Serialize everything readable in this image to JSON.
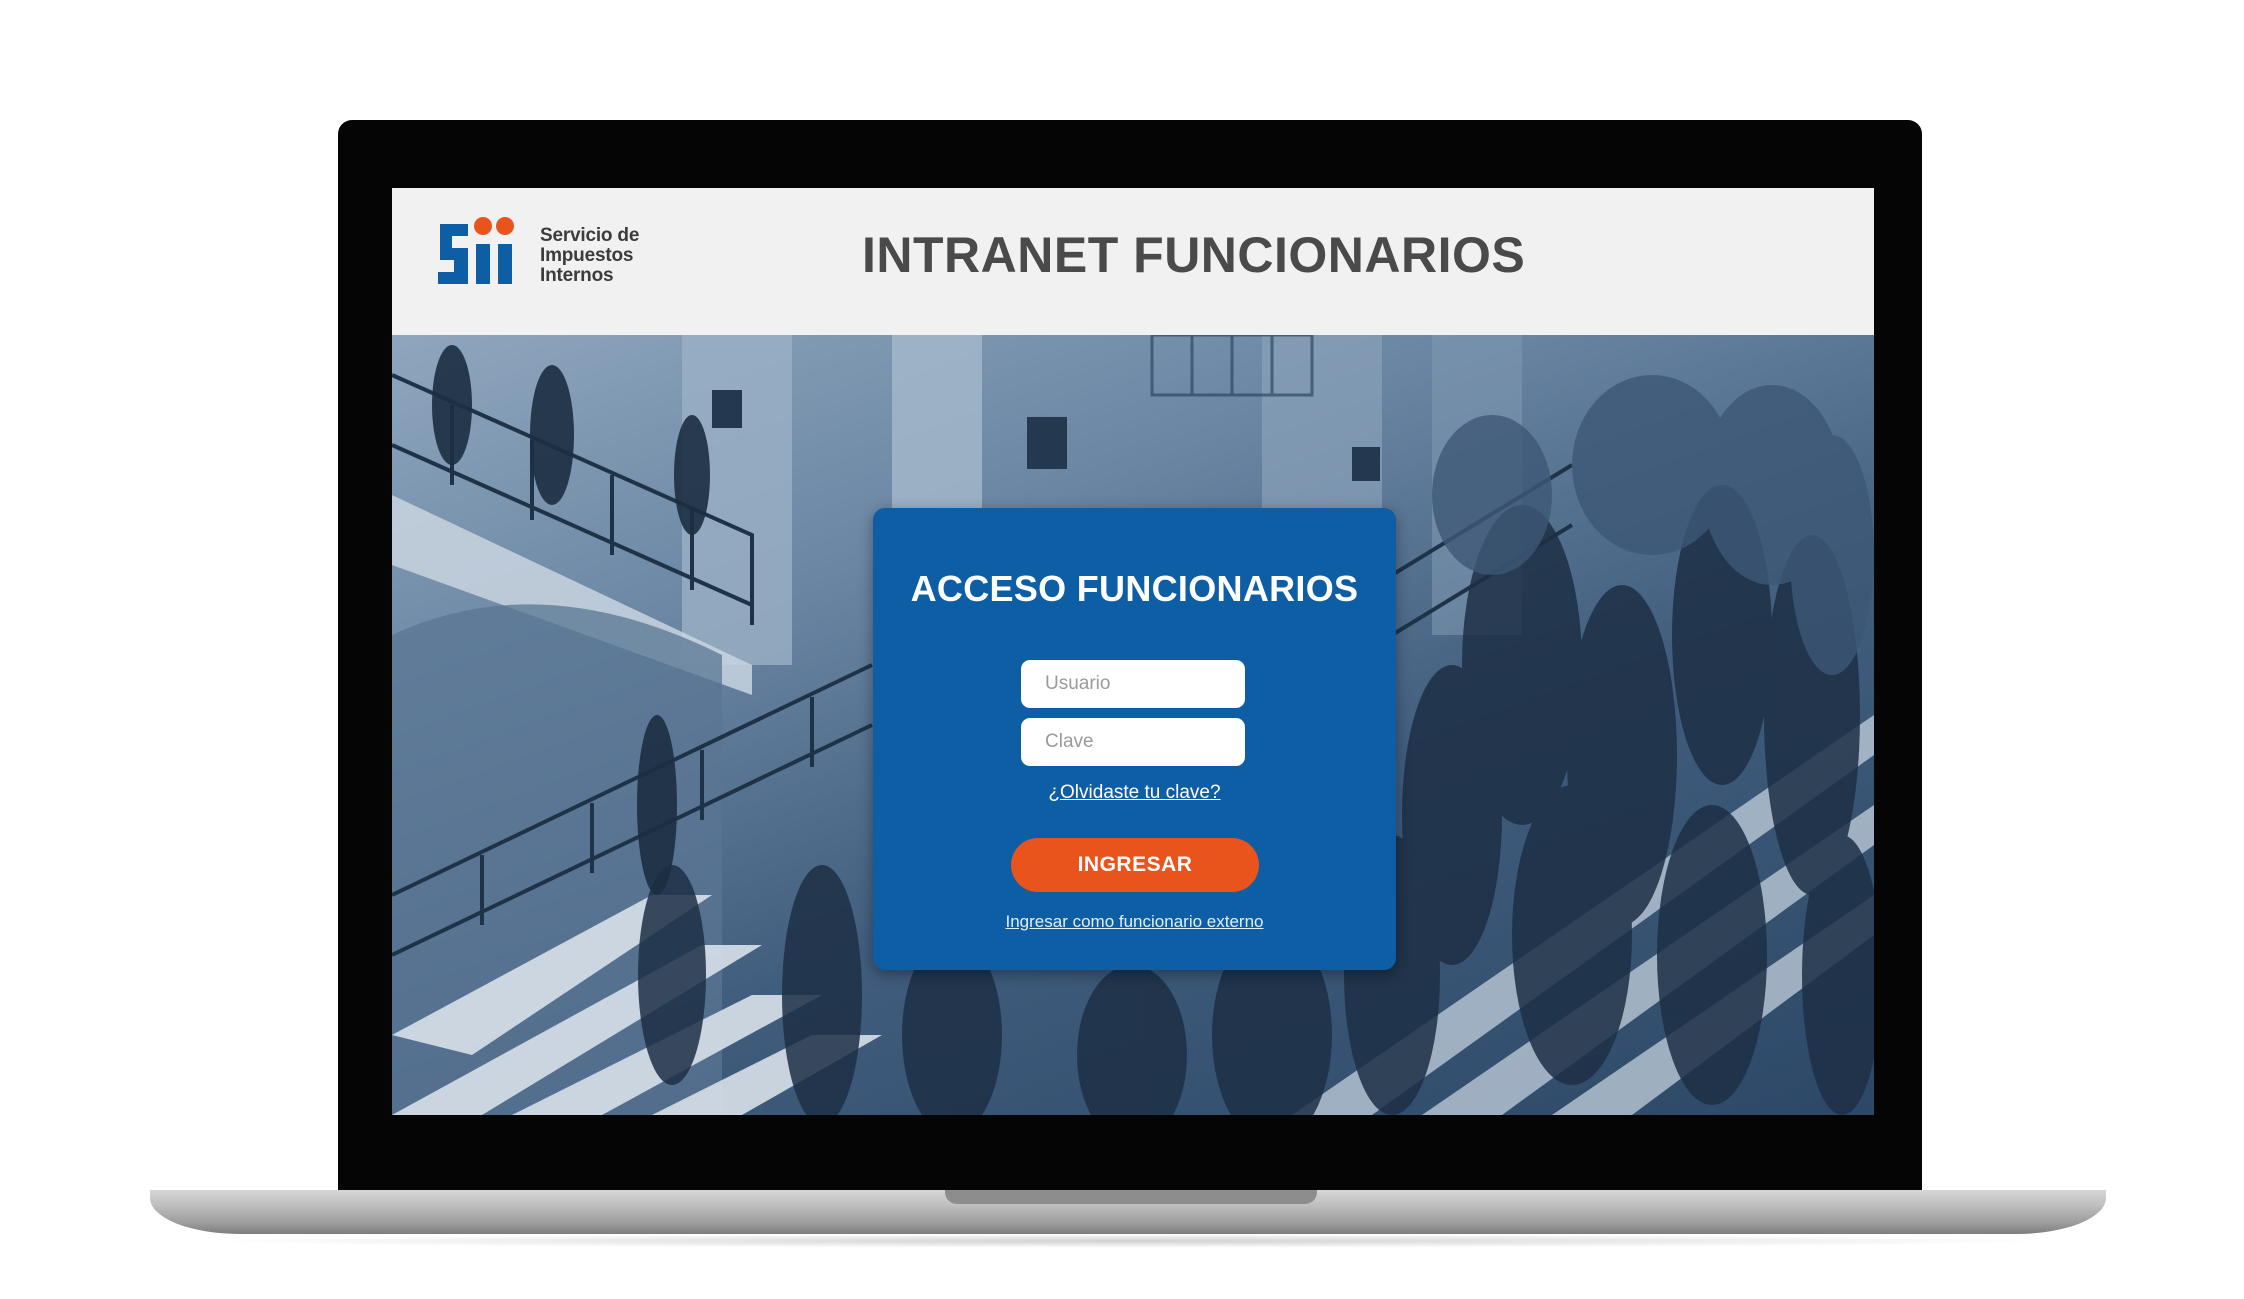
{
  "header": {
    "logo_mark": "Sii",
    "logo_text": [
      "Servicio de",
      "Impuestos",
      "Internos"
    ],
    "title": "INTRANET FUNCIONARIOS"
  },
  "login": {
    "title": "ACCESO FUNCIONARIOS",
    "user_placeholder": "Usuario",
    "user_value": "",
    "password_placeholder": "Clave",
    "password_value": "",
    "forgot_link": "¿Olvidaste tu clave?",
    "submit_label": "INGRESAR",
    "external_link": "Ingresar como funcionario externo"
  },
  "colors": {
    "brand_blue": "#0d5ea4",
    "brand_orange": "#e8541b",
    "header_bg": "#f1f1f1"
  },
  "icons": {
    "logo": "sii-logo-icon"
  }
}
